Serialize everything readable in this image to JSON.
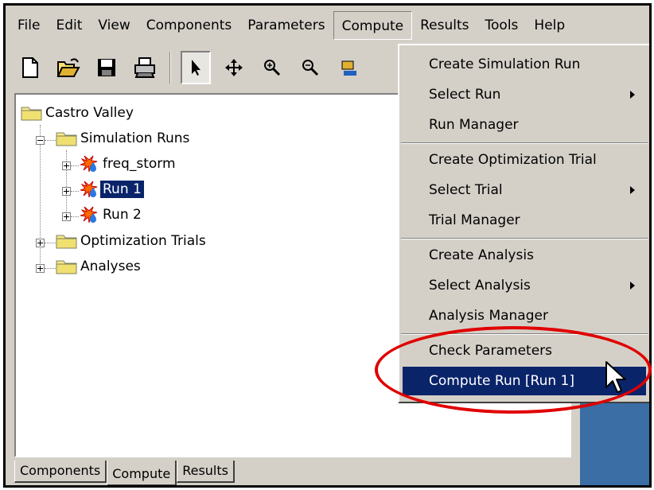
{
  "menubar": {
    "items": [
      "File",
      "Edit",
      "View",
      "Components",
      "Parameters",
      "Compute",
      "Results",
      "Tools",
      "Help"
    ]
  },
  "toolbar": {
    "buttons": [
      "new-icon",
      "open-folder-icon",
      "save-icon",
      "print-icon",
      "arrow-pointer-icon",
      "move-icon",
      "zoom-in-icon",
      "zoom-out-icon",
      "component-icon"
    ]
  },
  "tree": {
    "root": "Castro Valley",
    "simulation_runs": "Simulation Runs",
    "runs": [
      "freq_storm",
      "Run 1",
      "Run 2"
    ],
    "optimization_trials": "Optimization Trials",
    "analyses": "Analyses"
  },
  "tabs": [
    "Components",
    "Compute",
    "Results"
  ],
  "compute_menu": {
    "items": [
      "Create Simulation Run",
      "Select Run",
      "Run Manager",
      "Create Optimization Trial",
      "Select Trial",
      "Trial Manager",
      "Create Analysis",
      "Select Analysis",
      "Analysis Manager",
      "Check Parameters",
      "Compute Run [Run 1]"
    ]
  },
  "colors": {
    "selection": "#0a246a",
    "highlight_ellipse": "#e00000",
    "desktop_blue": "#3a6ea5",
    "chrome": "#d4d0c8"
  }
}
